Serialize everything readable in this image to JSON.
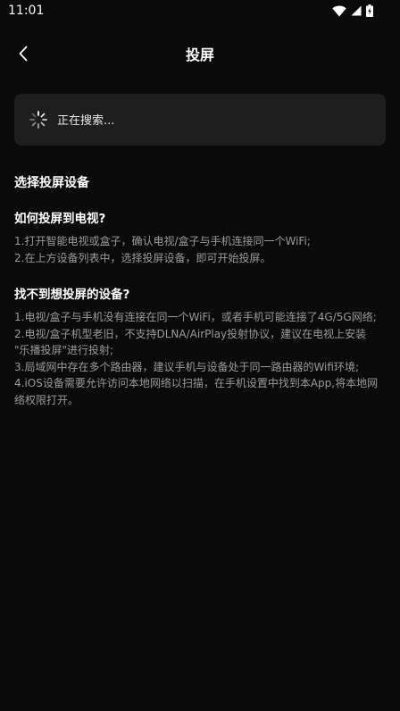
{
  "status_bar": {
    "time": "11:01",
    "icons": [
      "wifi-icon",
      "cellular-signal-icon",
      "battery-charging-icon"
    ]
  },
  "header": {
    "title": "投屏",
    "back_icon": "chevron-left-icon"
  },
  "search": {
    "status_text": "正在搜索...",
    "icon": "loading-spinner-icon"
  },
  "device_section": {
    "title": "选择投屏设备"
  },
  "how_to": {
    "title": "如何投屏到电视?",
    "lines": [
      "1.打开智能电视或盒子，确认电视/盒子与手机连接同一个WiFi;",
      "2.在上方设备列表中，选择投屏设备，即可开始投屏。"
    ]
  },
  "not_found": {
    "title": "找不到想投屏的设备?",
    "lines": [
      "1.电视/盒子与手机没有连接在同一个WiFi，或者手机可能连接了4G/5G网络;",
      "2.电视/盒子机型老旧，不支持DLNA/AirPlay投射协议，建议在电视上安装",
      "\"乐播投屏\"进行投射;",
      "3.局域网中存在多个路由器，建议手机与设备处于同一路由器的Wifi环境;",
      "4.iOS设备需要允许访问本地网络以扫描，在手机设置中找到本App,将本地网",
      "络权限打开。"
    ]
  },
  "colors": {
    "background": "#0a0a0a",
    "card": "#1e1e1e",
    "text_primary": "#ffffff",
    "text_secondary": "#9a9a9a"
  }
}
